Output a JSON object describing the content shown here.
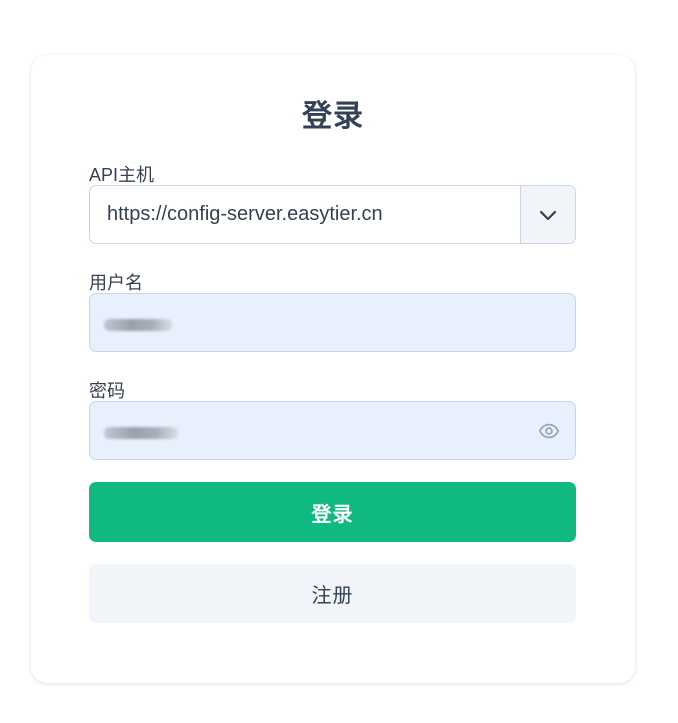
{
  "login": {
    "title": "登录",
    "api_host": {
      "label": "API主机",
      "value": "https://config-server.easytier.cn"
    },
    "username": {
      "label": "用户名"
    },
    "password": {
      "label": "密码"
    },
    "submit_label": "登录",
    "register_label": "注册"
  },
  "icons": {
    "dropdown": "chevron-down-icon",
    "show_password": "eye-icon"
  },
  "colors": {
    "primary": "#10b981",
    "secondary_bg": "#f1f5f9",
    "autofill_bg": "#e8f0fe",
    "text": "#334155"
  }
}
